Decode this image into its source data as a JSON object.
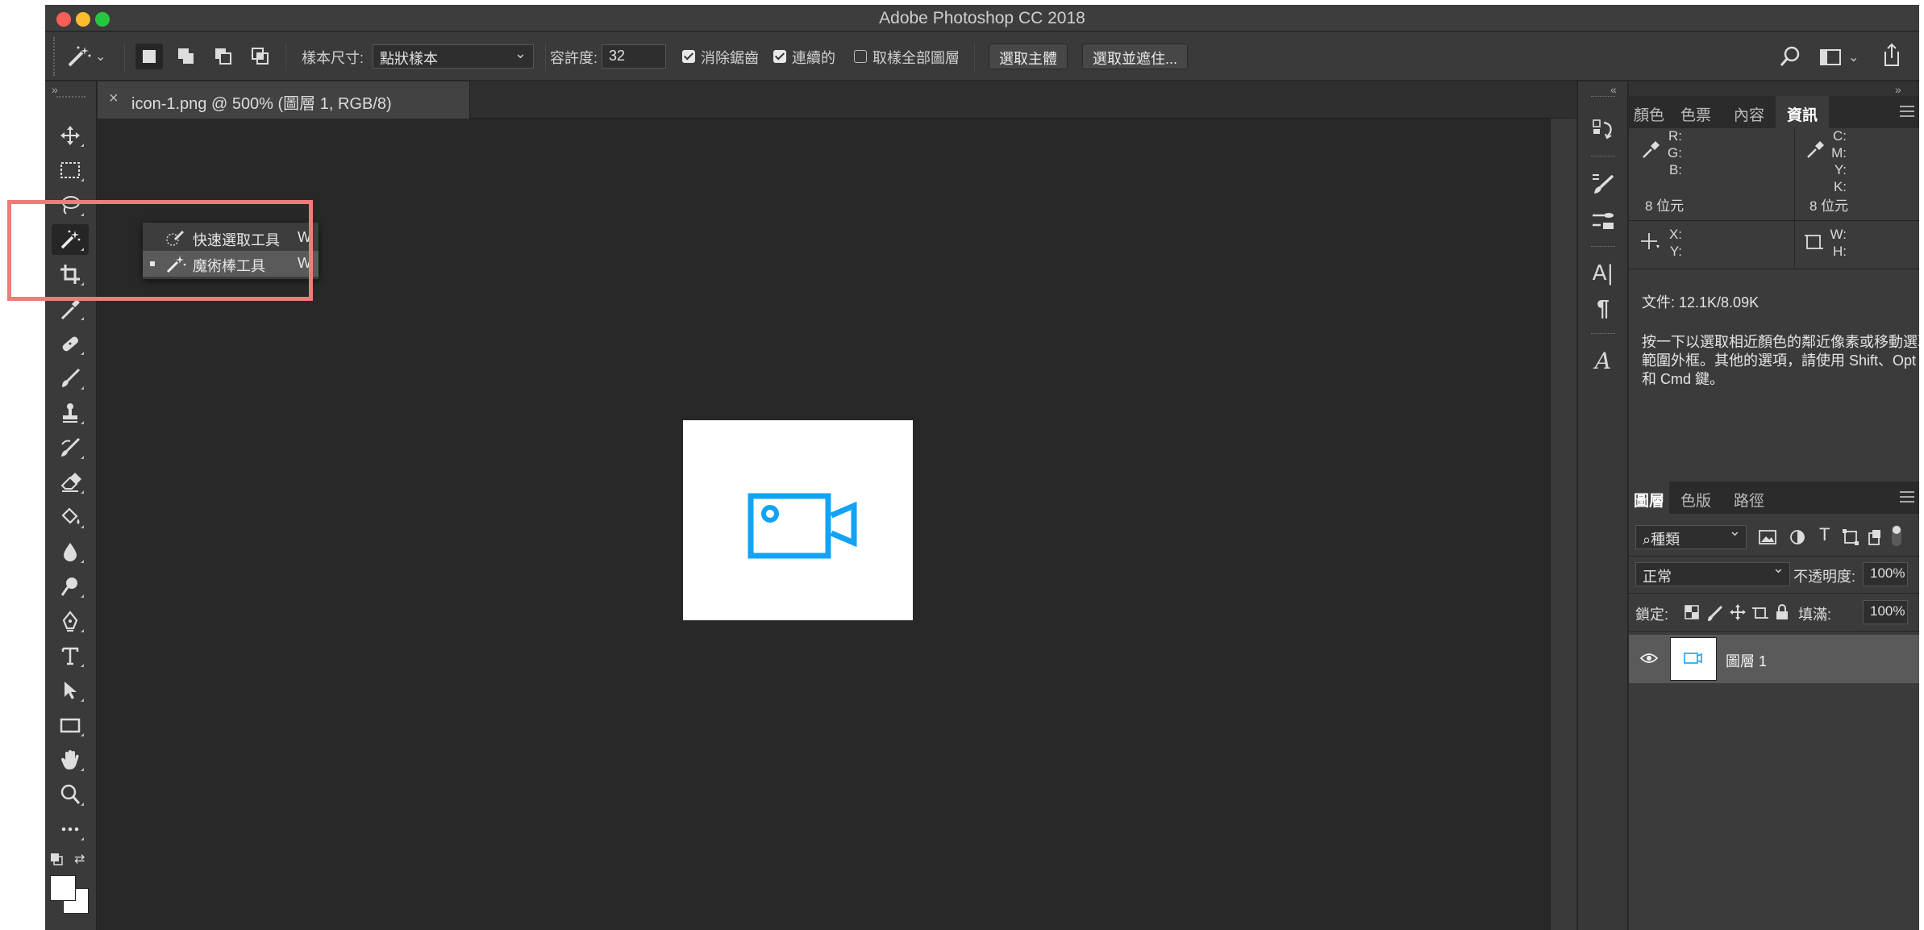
{
  "window": {
    "title": "Adobe Photoshop CC 2018"
  },
  "options_bar": {
    "sample_size_label": "樣本尺寸:",
    "sample_size_value": "點狀樣本",
    "tolerance_label": "容許度:",
    "tolerance_value": "32",
    "anti_alias_label": "消除鋸齒",
    "anti_alias_checked": true,
    "contiguous_label": "連續的",
    "contiguous_checked": true,
    "sample_all_layers_label": "取樣全部圖層",
    "sample_all_layers_checked": false,
    "select_subject_label": "選取主體",
    "select_and_mask_label": "選取並遮住..."
  },
  "document": {
    "tab_title": "icon-1.png @ 500% (圖層 1, RGB/8)",
    "close_glyph": "×",
    "icon_color": "#12a3f5"
  },
  "flyout": {
    "items": [
      {
        "label": "快速選取工具",
        "shortcut": "W",
        "selected": false
      },
      {
        "label": "魔術棒工具",
        "shortcut": "W",
        "selected": true
      }
    ]
  },
  "top_panel": {
    "tabs": [
      "顏色",
      "色票",
      "內容",
      "資訊"
    ],
    "active_tab": "資訊",
    "info": {
      "rgb_labels": [
        "R:",
        "G:",
        "B:"
      ],
      "cmyk_labels": [
        "C:",
        "M:",
        "Y:",
        "K:"
      ],
      "bits_left": "8 位元",
      "bits_right": "8 位元",
      "xy_labels": [
        "X:",
        "Y:"
      ],
      "wh_labels": [
        "W:",
        "H:"
      ],
      "doc_size": "文件: 12.1K/8.09K",
      "hint_lines": [
        "按一下以選取相近顏色的鄰近像素或移動選取",
        "範圍外框。其他的選項，請使用 Shift、Opt",
        "和 Cmd 鍵。"
      ]
    }
  },
  "layers_panel": {
    "tabs": [
      "圖層",
      "色版",
      "路徑"
    ],
    "active_tab": "圖層",
    "filter_label": "種類",
    "blend_mode": "正常",
    "opacity_label": "不透明度:",
    "opacity_value": "100%",
    "lock_label": "鎖定:",
    "fill_label": "填滿:",
    "fill_value": "100%",
    "layers": [
      {
        "name": "圖層 1",
        "visible": true
      }
    ]
  },
  "colors": {
    "accent_highlight": "#f07c79",
    "traffic_red": "#fd5f57",
    "traffic_yellow": "#febc2e",
    "traffic_green": "#27c840"
  }
}
